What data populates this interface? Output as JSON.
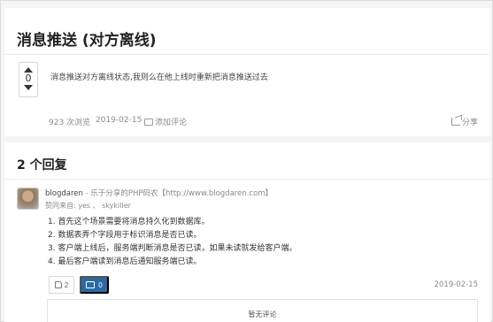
{
  "question": {
    "title": "消息推送 (对方离线)",
    "vote_count": "0",
    "body": "消息推送对方离线状态,我则么在他上线时重新把消息推送过去",
    "views": "923 次浏览",
    "date": "2019-02-15",
    "add_comment": "添加评论",
    "share": "分享"
  },
  "answers": {
    "header": "2 个回复",
    "items": [
      {
        "author": "blogdaren",
        "bio": " - 乐于分享的PHP码农【http://www.blogdaren.com】",
        "invited": "赞同来自: yes 、 skykiller",
        "lines": [
          "1.  首先这个场景需要将消息持久化到数据库。",
          "2.  数据表弄个字段用于标识消息是否已读。",
          "3.  客户端上线后，服务端判断消息是否已读，如果未读就发给客户端。",
          "4.  最后客户端读到消息后通知服务端已读。"
        ],
        "likes": "2",
        "comments": "0",
        "date": "2019-02-15",
        "no_comment": "暂无评论"
      }
    ]
  },
  "colors": {
    "accent": "#2a6aa3",
    "muted_text": "#8a8a8a",
    "page_bg": "#f4f5f7"
  }
}
